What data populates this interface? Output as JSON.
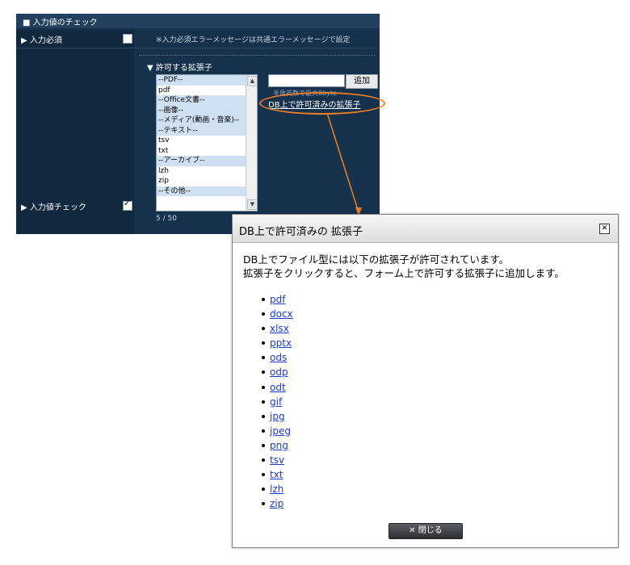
{
  "panel": {
    "header": "■ 入力値のチェック",
    "row_required_label": "▶ 入力必須",
    "required_note": "※入力必須エラーメッセージは共通エラーメッセージで設定",
    "row_check_label": "▶ 入力値チェック",
    "section_title": "▼ 許可する拡張子",
    "list_options": [
      {
        "text": "--PDF--",
        "group": true
      },
      {
        "text": "pdf",
        "group": false
      },
      {
        "text": "--Office文書--",
        "group": true
      },
      {
        "text": "--画像--",
        "group": true
      },
      {
        "text": "--メディア(動画・音楽)--",
        "group": true
      },
      {
        "text": "--テキスト--",
        "group": true
      },
      {
        "text": "tsv",
        "group": false
      },
      {
        "text": "txt",
        "group": false
      },
      {
        "text": "--アーカイブ--",
        "group": true
      },
      {
        "text": "lzh",
        "group": false
      },
      {
        "text": "zip",
        "group": false
      },
      {
        "text": "--その他--",
        "group": true
      }
    ],
    "counter": "5 / 50",
    "add_button": "追加",
    "hint": "半角英数で最大8byte",
    "db_link": "DB上で許可済みの拡張子",
    "required_checked": false,
    "check_checked": true
  },
  "dialog": {
    "title": "DB上で許可済みの 拡張子",
    "message_line1": "DB上でファイル型には以下の拡張子が許可されています。",
    "message_line2": "拡張子をクリックすると、フォーム上で許可する拡張子に追加します。",
    "extensions": [
      "pdf",
      "docx",
      "xlsx",
      "pptx",
      "ods",
      "odp",
      "odt",
      "gif",
      "jpg",
      "jpeg",
      "png",
      "tsv",
      "txt",
      "lzh",
      "zip"
    ],
    "close_label": "閉じる",
    "close_icon": "x-icon"
  },
  "colors": {
    "panel_bg": "#16314b",
    "highlight": "#f07d22",
    "link": "#1a3bd0"
  }
}
